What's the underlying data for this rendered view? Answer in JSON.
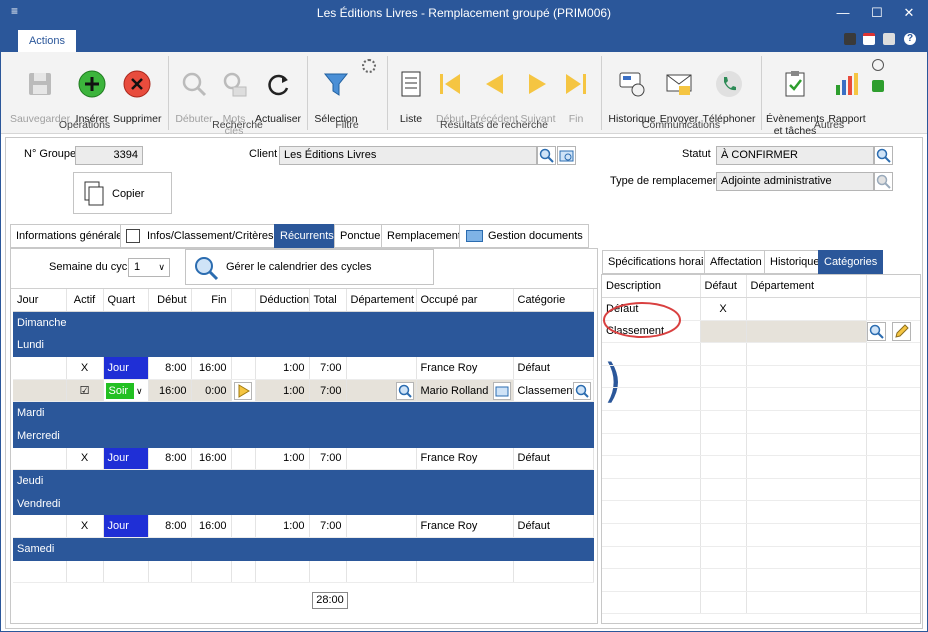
{
  "window": {
    "title": "Les Éditions Livres - Remplacement groupé (PRIM006)"
  },
  "ribbon": {
    "tab": "Actions",
    "buttons": [
      {
        "label": "Sauvegarder",
        "enabled": false
      },
      {
        "label": "Insérer",
        "enabled": true
      },
      {
        "label": "Supprimer",
        "enabled": true
      },
      {
        "label": "Débuter",
        "enabled": false
      },
      {
        "label": "Mots\nclés",
        "enabled": false
      },
      {
        "label": "Actualiser",
        "enabled": true
      },
      {
        "label": "Sélection",
        "enabled": true
      },
      {
        "label": "Liste",
        "enabled": true
      },
      {
        "label": "Début",
        "enabled": false
      },
      {
        "label": "Précédent",
        "enabled": false
      },
      {
        "label": "Suivant",
        "enabled": false
      },
      {
        "label": "Fin",
        "enabled": false
      },
      {
        "label": "Historique",
        "enabled": true
      },
      {
        "label": "Envoyer",
        "enabled": true
      },
      {
        "label": "Téléphoner",
        "enabled": true
      },
      {
        "label": "Évènements\net tâches",
        "enabled": true
      },
      {
        "label": "Rapport",
        "enabled": true
      }
    ],
    "groups": [
      "Opérations",
      "Recherche",
      "Filtre",
      "Résultats de recherche",
      "Communications",
      "Autres"
    ]
  },
  "form": {
    "groupe_label": "N° Groupe",
    "groupe_value": "3394",
    "client_label": "Client",
    "client_value": "Les Éditions Livres",
    "statut_label": "Statut",
    "statut_value": "À CONFIRMER",
    "type_label": "Type de remplacement",
    "type_value": "Adjointe administrative",
    "copier": "Copier"
  },
  "tabs": [
    "Informations générales",
    "Infos/Classement/Critères",
    "Récurrents",
    "Ponctuel",
    "Remplacements",
    "Gestion documents"
  ],
  "cycle": {
    "label": "Semaine du cycle",
    "value": "1",
    "manage": "Gérer le calendrier des cycles"
  },
  "grid": {
    "headers": [
      "Jour",
      "Actif",
      "Quart",
      "Début",
      "Fin",
      "",
      "Déduction",
      "Total",
      "Département",
      "Occupé par",
      "Catégorie"
    ],
    "rows": [
      {
        "type": "day",
        "jour": "Dimanche"
      },
      {
        "type": "day",
        "jour": "Lundi"
      },
      {
        "type": "shift",
        "actif": "X",
        "quart": "Jour",
        "debut": "8:00",
        "fin": "16:00",
        "deduction": "1:00",
        "total": "7:00",
        "occupe": "France Roy",
        "categorie": "Défaut"
      },
      {
        "type": "edit",
        "actif": "☑",
        "quart": "Soir",
        "debut": "16:00",
        "fin": "0:00",
        "deduction": "1:00",
        "total": "7:00",
        "occupe": "Mario Rolland",
        "categorie": "Classement"
      },
      {
        "type": "day",
        "jour": "Mardi"
      },
      {
        "type": "day",
        "jour": "Mercredi"
      },
      {
        "type": "shift",
        "actif": "X",
        "quart": "Jour",
        "debut": "8:00",
        "fin": "16:00",
        "deduction": "1:00",
        "total": "7:00",
        "occupe": "France Roy",
        "categorie": "Défaut"
      },
      {
        "type": "day",
        "jour": "Jeudi"
      },
      {
        "type": "day",
        "jour": "Vendredi"
      },
      {
        "type": "shift",
        "actif": "X",
        "quart": "Jour",
        "debut": "8:00",
        "fin": "16:00",
        "deduction": "1:00",
        "total": "7:00",
        "occupe": "France Roy",
        "categorie": "Défaut"
      },
      {
        "type": "day",
        "jour": "Samedi"
      }
    ],
    "total": "28:00"
  },
  "right_tabs": [
    "Spécifications horaire",
    "Affectation",
    "Historique",
    "Catégories"
  ],
  "categories": {
    "headers": [
      "Description",
      "Défaut",
      "Département"
    ],
    "rows": [
      {
        "description": "Défaut",
        "defaut": "X"
      },
      {
        "description": "Classement",
        "defaut": ""
      }
    ]
  },
  "colors": {
    "accent": "#2b579a",
    "jour": "#1f2fd6",
    "soir": "#22c022"
  }
}
